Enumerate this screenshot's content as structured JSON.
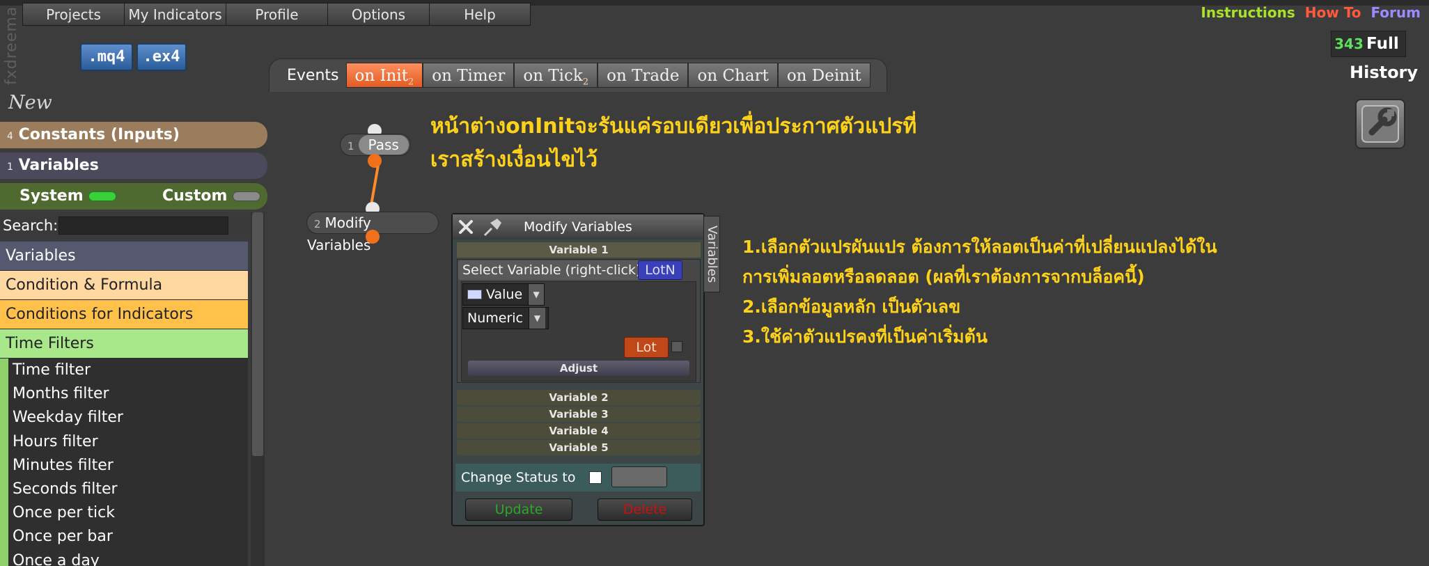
{
  "brand": "fxdreema",
  "menu": [
    "Projects",
    "My Indicators",
    "Profile",
    "Options",
    "Help"
  ],
  "file_buttons": {
    "mq4": ".mq4",
    "ex4": ".ex4"
  },
  "top_links": {
    "instructions": "Instructions",
    "howto": "How To",
    "forum": "Forum"
  },
  "counter": {
    "value": "343",
    "label": "Full"
  },
  "history_label": "History",
  "events_label": "Events",
  "tabs": [
    {
      "label": "on Init",
      "badge": "2"
    },
    {
      "label": "on Timer",
      "badge": ""
    },
    {
      "label": "on Tick",
      "badge": "2"
    },
    {
      "label": "on Trade",
      "badge": ""
    },
    {
      "label": "on Chart",
      "badge": ""
    },
    {
      "label": "on Deinit",
      "badge": ""
    }
  ],
  "sidebar": {
    "new_label": "New",
    "constants": {
      "count": "4",
      "label": "Constants (Inputs)"
    },
    "variables": {
      "count": "1",
      "label": "Variables"
    },
    "system_label": "System",
    "custom_label": "Custom",
    "search_label": "Search:",
    "search_value": "",
    "categories": [
      "Variables",
      "Condition & Formula",
      "Conditions for Indicators",
      "Time Filters"
    ],
    "filters": [
      "Time filter",
      "Months filter",
      "Weekday filter",
      "Hours filter",
      "Minutes filter",
      "Seconds filter",
      "Once per tick",
      "Once per bar",
      "Once a day"
    ]
  },
  "blocks": {
    "pass": {
      "num": "1",
      "label": "Pass"
    },
    "modify": {
      "num": "2",
      "label": "Modify Variables"
    }
  },
  "annotation_title": [
    "หน้าต่างonInitจะรันแค่รอบเดียวเพื่อประกาศตัวแปรที่",
    "เราสร้างเงื่อนไขไว้"
  ],
  "annotation_notes": [
    "1.เลือกตัวแปรผันแปร ต้องการให้ลอตเป็นค่าที่เปลี่ยนแปลงได้ใน",
    "การเพิ่มลอตหรือลดลอต (ผลที่เราต้องการจากบล็อคนี้)",
    "2.เลือกข้อมูลหลัก เป็นตัวเลข",
    "3.ใช้ค่าตัวแปรคงที่เป็นค่าเริ่มต้น"
  ],
  "panel": {
    "title": "Modify Variables",
    "side_tab": "Variables",
    "var1_header": "Variable 1",
    "select_label": "Select Variable (right-click)",
    "selected_var": "LotN",
    "value_type": "Value",
    "data_type": "Numeric",
    "lot_button": "Lot",
    "adjust_label": "Adjust",
    "other_vars": [
      "Variable 2",
      "Variable 3",
      "Variable 4",
      "Variable 5"
    ],
    "change_status_label": "Change Status to",
    "update_label": "Update",
    "delete_label": "Delete"
  },
  "colors": {
    "annotation": "#ffd21a",
    "active_tab": "#f26a2a",
    "instructions": "#a8e22a",
    "howto": "#ff5a3c",
    "forum": "#9a8cff",
    "update": "#2aaa2a",
    "delete": "#cc1111"
  }
}
